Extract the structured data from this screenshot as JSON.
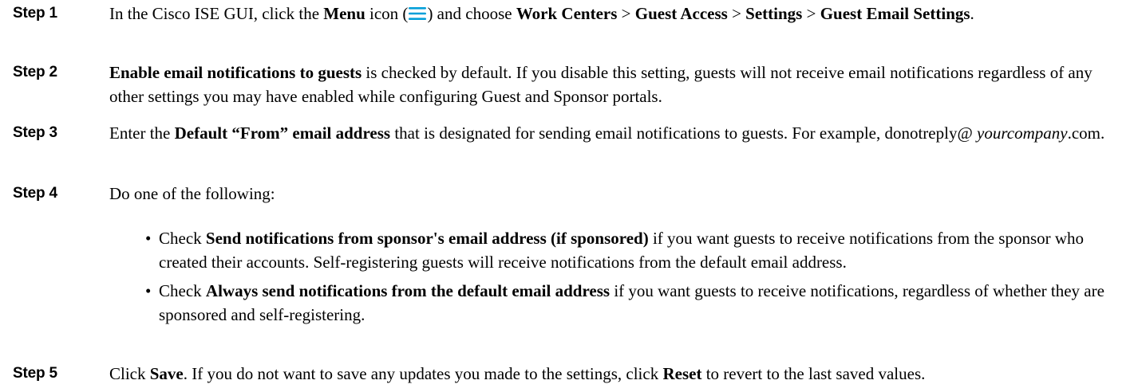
{
  "steps": [
    {
      "label": "Step 1",
      "segments": {
        "t1": "In the Cisco ISE GUI, click the ",
        "b1": "Menu",
        "t2": " icon (",
        "t3": ") and choose ",
        "b2": "Work Centers",
        "t4": " > ",
        "b3": "Guest Access",
        "t5": " > ",
        "b4": "Settings",
        "t6": " > ",
        "b5": "Guest Email Settings",
        "t7": "."
      }
    },
    {
      "label": "Step 2",
      "segments": {
        "b1": "Enable email notifications to guests",
        "t1": " is checked by default. If you disable this setting, guests will not receive email notifications regardless of any other settings you may have enabled while configuring Guest and Sponsor portals."
      }
    },
    {
      "label": "Step 3",
      "segments": {
        "t1": "Enter the ",
        "b1": "Default “From” email address",
        "t2": " that is designated for sending email notifications to guests. For example, donotreply@ ",
        "i1": "yourcompany",
        "t3": ".com."
      }
    },
    {
      "label": "Step 4",
      "segments": {
        "t1": "Do one of the following:"
      },
      "bullets": [
        {
          "mark": "•",
          "t1": "Check ",
          "b1": "Send notifications from sponsor's email address (if sponsored)",
          "t2": " if you want guests to receive notifications from the sponsor who created their accounts. Self-registering guests will receive notifications from the default email address."
        },
        {
          "mark": "•",
          "t1": "Check ",
          "b1": "Always send notifications from the default email address",
          "t2": " if you want guests to receive notifications, regardless of whether they are sponsored and self-registering."
        }
      ]
    },
    {
      "label": "Step 5",
      "segments": {
        "t1": "Click ",
        "b1": "Save",
        "t2": ". If you do not want to save any updates you made to the settings, click ",
        "b2": "Reset",
        "t3": " to revert to the last saved values."
      }
    }
  ],
  "icons": {
    "menu_icon": "hamburger-menu-icon",
    "menu_icon_color": "#049fd9"
  }
}
